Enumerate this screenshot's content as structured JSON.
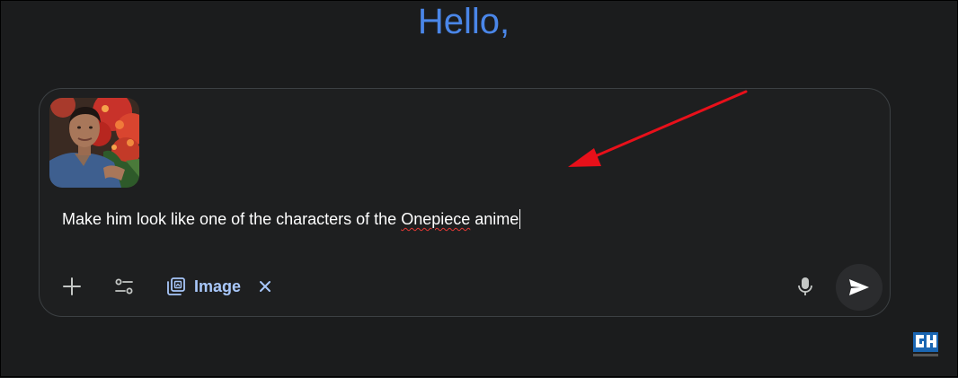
{
  "greeting": "Hello,",
  "composer": {
    "prompt_before": "Make him look like one of the characters of the ",
    "prompt_misspelled": "Onepiece",
    "prompt_after": " anime",
    "image_chip_label": "Image"
  },
  "icons": {
    "add": "plus-icon",
    "tools": "tools-sliders-icon",
    "image_chip": "image-gallery-icon",
    "remove_chip": "close-icon",
    "mic": "microphone-icon",
    "send": "send-icon"
  },
  "colors": {
    "background": "#1b1c1d",
    "greeting": "#4a86e8",
    "chip": "#a8c7fa",
    "annotation_arrow": "#e8101a",
    "spellcheck": "#e53935"
  }
}
